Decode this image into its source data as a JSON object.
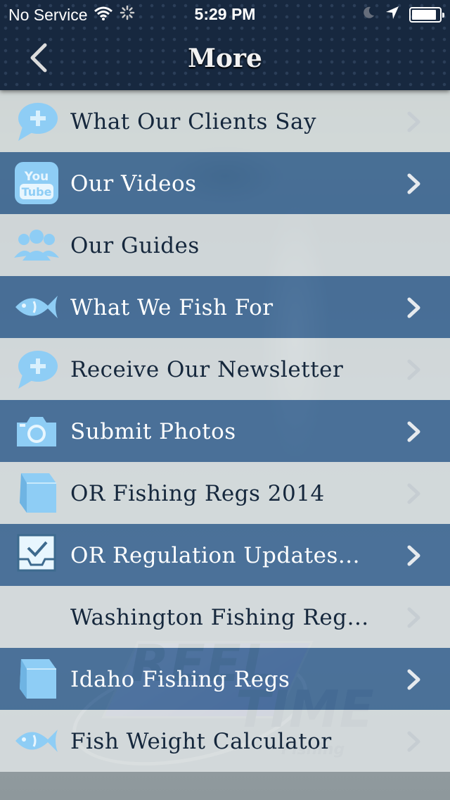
{
  "status_bar": {
    "carrier": "No Service",
    "time": "5:29 PM"
  },
  "nav": {
    "title": "More"
  },
  "menu": [
    {
      "label": "What Our Clients Say",
      "icon": "speech-bubble-plus-icon",
      "style": "light",
      "chevron": true
    },
    {
      "label": "Our Videos",
      "icon": "youtube-icon",
      "style": "blue",
      "chevron": true
    },
    {
      "label": "Our Guides",
      "icon": "people-group-icon",
      "style": "light",
      "chevron": false
    },
    {
      "label": "What We Fish For",
      "icon": "fish-icon",
      "style": "blue",
      "chevron": true
    },
    {
      "label": "Receive Our Newsletter",
      "icon": "speech-bubble-plus-icon",
      "style": "light",
      "chevron": true
    },
    {
      "label": "Submit Photos",
      "icon": "camera-icon",
      "style": "blue",
      "chevron": true
    },
    {
      "label": "OR Fishing Regs 2014",
      "icon": "book-icon",
      "style": "light",
      "chevron": true
    },
    {
      "label": "OR Regulation Updates...",
      "icon": "inbox-check-icon",
      "style": "blue",
      "chevron": true
    },
    {
      "label": "Washington Fishing Reg...",
      "icon": "",
      "style": "light",
      "chevron": true
    },
    {
      "label": "Idaho Fishing Regs",
      "icon": "book-icon",
      "style": "blue",
      "chevron": true
    },
    {
      "label": "Fish Weight Calculator",
      "icon": "fish-icon",
      "style": "light",
      "chevron": true
    }
  ],
  "watermark": {
    "text_line1": "REEL",
    "text_line2": "TIME",
    "text_line3": "Fishing"
  },
  "colors": {
    "nav_bg": "#17283f",
    "row_light": "#e1e5e7",
    "row_blue": "#3a6696",
    "icon_blue": "#8ecdf5",
    "label_dark": "#15273c"
  }
}
